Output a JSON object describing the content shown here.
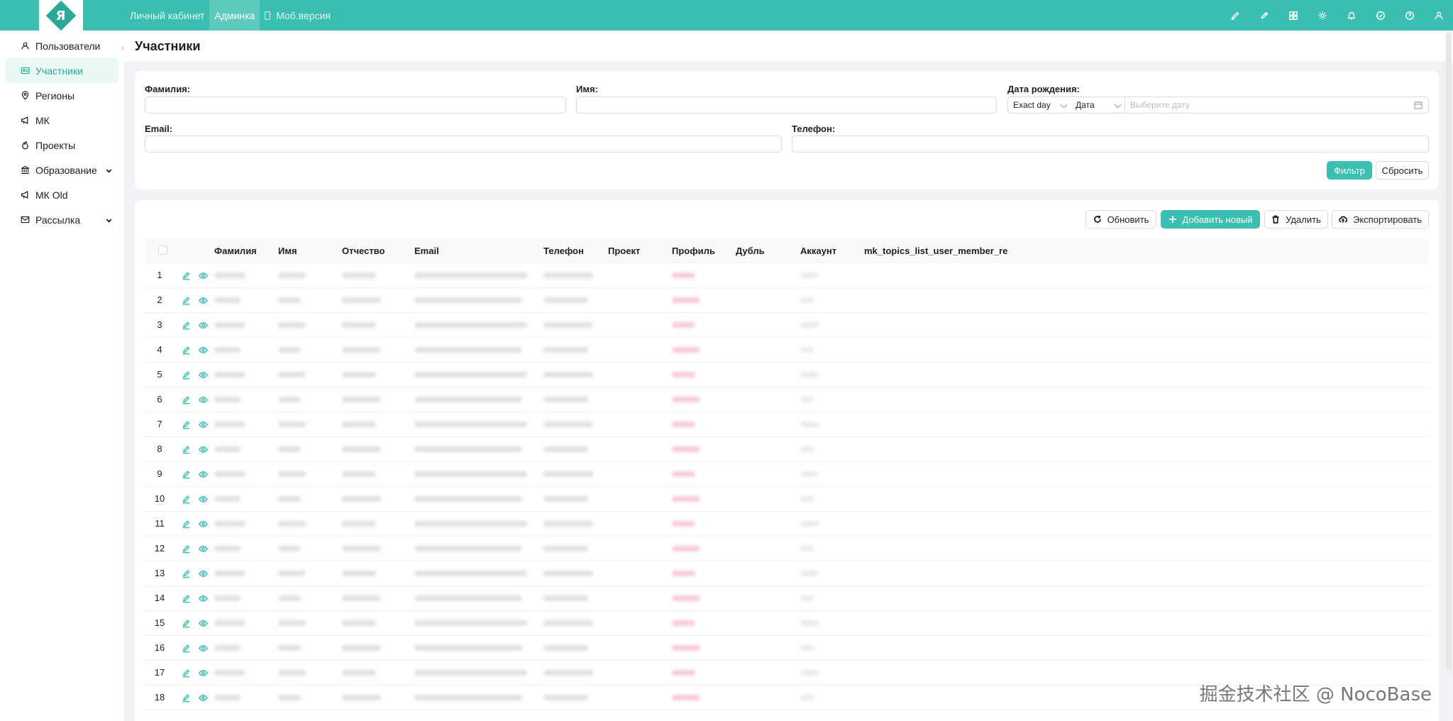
{
  "header": {
    "logo_letter": "Я",
    "nav": [
      {
        "label": "Личный кабинет",
        "active": false
      },
      {
        "label": "Админка",
        "active": true
      },
      {
        "label": "Моб.версия",
        "active": false
      }
    ],
    "icons": [
      "brush-icon",
      "pencil-icon",
      "grid-icon",
      "gear-icon",
      "bell-icon",
      "check-circle-icon",
      "help-icon",
      "user-icon"
    ]
  },
  "sidebar": {
    "items": [
      {
        "label": "Пользователи",
        "icon": "user-icon",
        "active": false,
        "expandable": false
      },
      {
        "label": "Участники",
        "icon": "id-card-icon",
        "active": true,
        "expandable": false
      },
      {
        "label": "Регионы",
        "icon": "location-icon",
        "active": false,
        "expandable": false
      },
      {
        "label": "МК",
        "icon": "megaphone-icon",
        "active": false,
        "expandable": false
      },
      {
        "label": "Проекты",
        "icon": "fire-icon",
        "active": false,
        "expandable": false
      },
      {
        "label": "Образование",
        "icon": "bank-icon",
        "active": false,
        "expandable": true
      },
      {
        "label": "МК Old",
        "icon": "megaphone-icon",
        "active": false,
        "expandable": false
      },
      {
        "label": "Рассылка",
        "icon": "mail-icon",
        "active": false,
        "expandable": true
      }
    ]
  },
  "page": {
    "title": "Участники"
  },
  "filter": {
    "surname_label": "Фамилия",
    "name_label": "Имя",
    "birth_label": "Дата рождения",
    "email_label": "Email",
    "phone_label": "Телефон",
    "birth_mode": "Exact day",
    "birth_type": "Дата",
    "birth_placeholder": "Выберите дату",
    "filter_button": "Фильтр",
    "reset_button": "Сбросить"
  },
  "toolbar": {
    "refresh": "Обновить",
    "add": "Добавить новый",
    "delete": "Удалить",
    "export": "Экспортировать"
  },
  "table": {
    "columns": [
      "Фамилия",
      "Имя",
      "Отчество",
      "Email",
      "Телефон",
      "Проект",
      "Профиль",
      "Дубль",
      "Аккаунт",
      "mk_topics_list_user_member_re"
    ],
    "rows": [
      1,
      2,
      3,
      4,
      5,
      6,
      7,
      8,
      9,
      10,
      11,
      12,
      13,
      14,
      15,
      16,
      17,
      18
    ]
  },
  "watermark": "掘金技术社区 @ NocoBase",
  "colors": {
    "accent": "#3bbfb0",
    "accent_dark": "#2aa898",
    "active_bg": "#e9f7f5"
  }
}
